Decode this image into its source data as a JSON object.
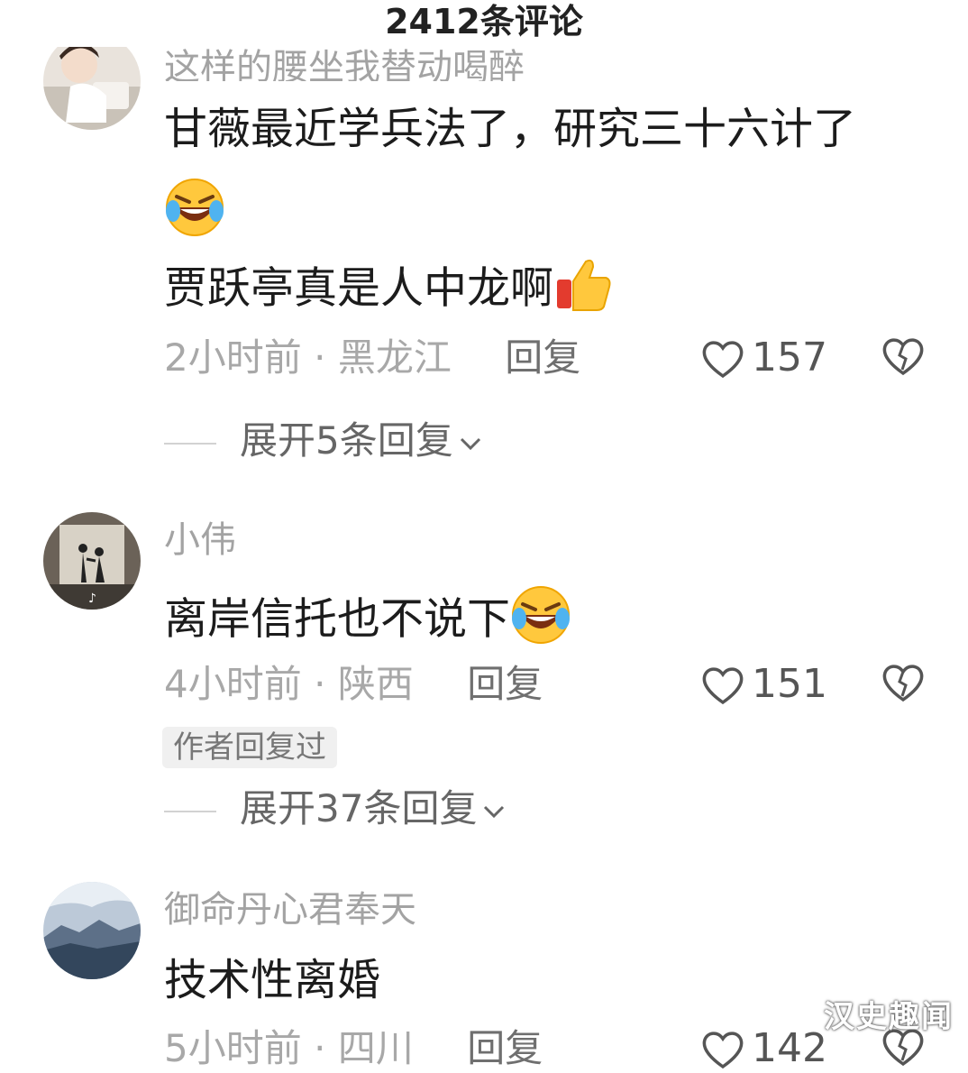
{
  "header": {
    "title": "2412条评论"
  },
  "comments": [
    {
      "username": "这样的腰坐我替动喝醉",
      "lines": [
        "甘薇最近学兵法了，研究三十六计了",
        "",
        "贾跃亭真是人中龙啊"
      ],
      "emoji_line2": "laughing-crying-emoji",
      "emoji_line3": "thumbs-up-emoji",
      "time": "2小时前",
      "location": "黑龙江",
      "reply_label": "回复",
      "likes": "157",
      "expand_label": "展开5条回复"
    },
    {
      "username": "小伟",
      "lines": [
        "离岸信托也不说下"
      ],
      "emoji_line1": "laughing-crying-emoji",
      "time": "4小时前",
      "location": "陕西",
      "reply_label": "回复",
      "likes": "151",
      "badge": "作者回复过",
      "expand_label": "展开37条回复"
    },
    {
      "username": "御命丹心君奉天",
      "lines": [
        "技术性离婚"
      ],
      "time": "5小时前",
      "location": "四川",
      "reply_label": "回复",
      "likes": "142"
    }
  ],
  "separator": "·",
  "watermark": "汉史趣闻",
  "colors": {
    "meta": "#a8a8a8",
    "text": "#1c1c1c",
    "accent": "#ffcc33"
  }
}
